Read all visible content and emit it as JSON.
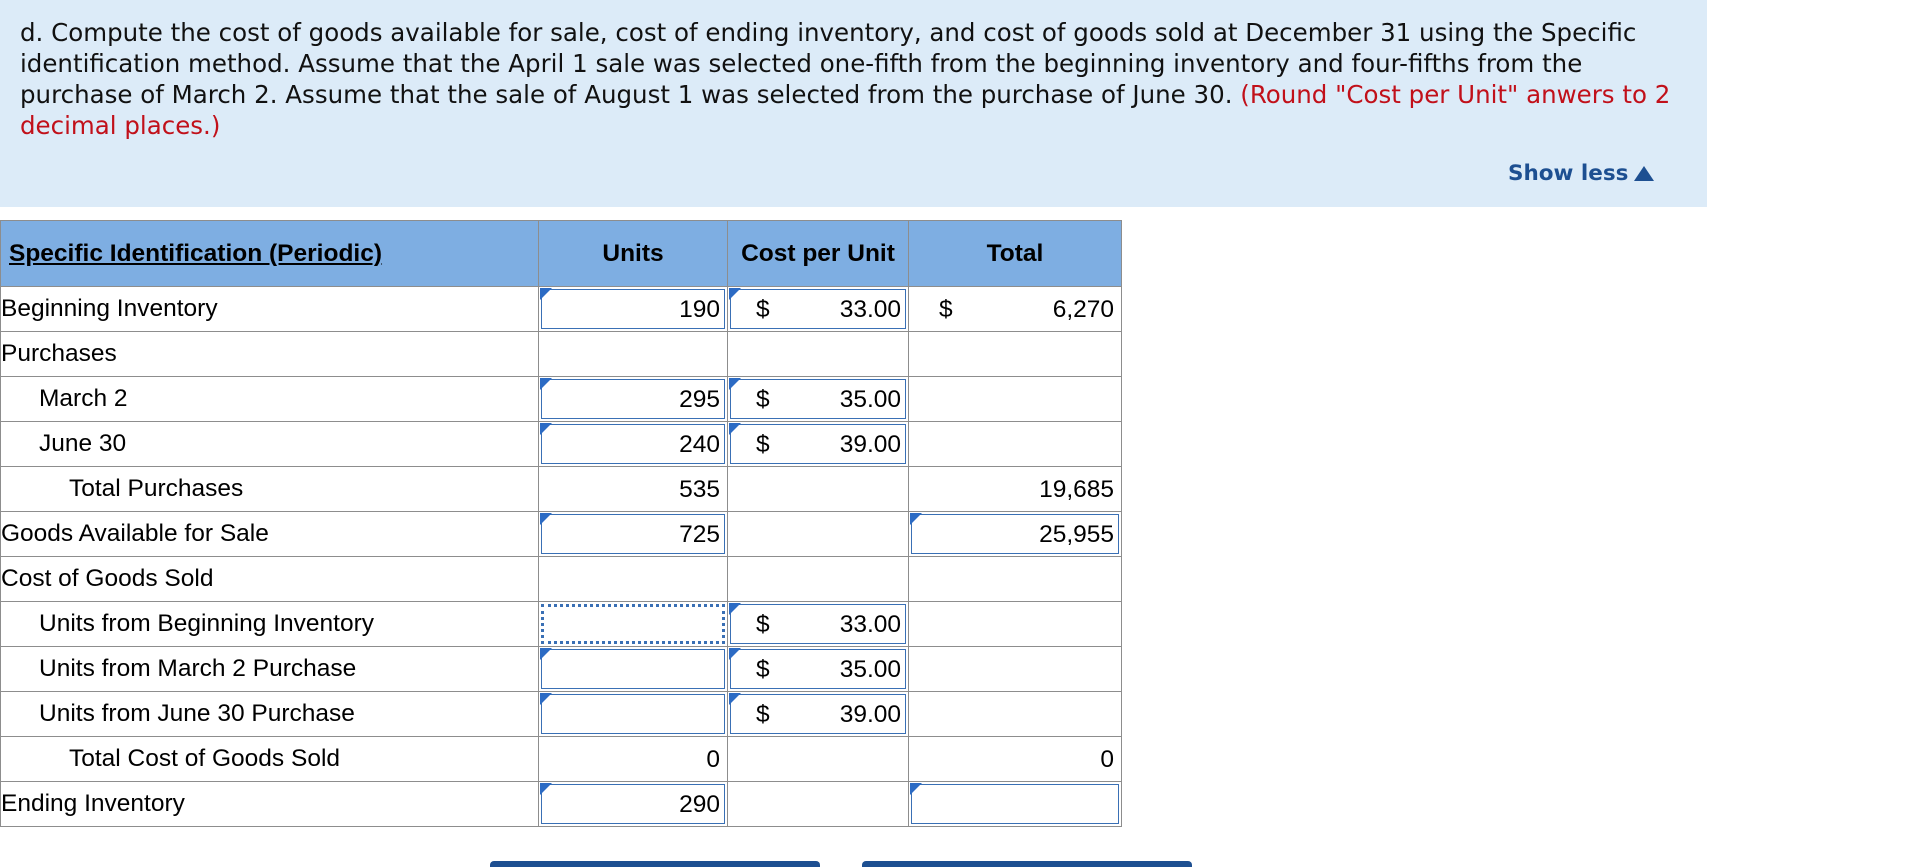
{
  "prompt": {
    "text": "d. Compute the cost of goods available for sale, cost of ending inventory, and cost of goods sold at December 31 using the Specific identification method. Assume that the April 1 sale was selected one-fifth from the beginning inventory and four-fifths from the purchase of March 2. Assume that the sale of August 1 was selected from the purchase of June 30. ",
    "note": "(Round \"Cost per Unit\" anwers to 2 decimal places.)",
    "show_less": "Show less"
  },
  "table": {
    "headers": {
      "label": "Specific Identification (Periodic)",
      "units": "Units",
      "cost": "Cost per Unit",
      "total": "Total"
    },
    "currency": "$",
    "rows": [
      {
        "label": "Beginning Inventory",
        "units": "190",
        "cost": "33.00",
        "total": "6,270"
      },
      {
        "label": "Purchases"
      },
      {
        "label": "March 2",
        "units": "295",
        "cost": "35.00"
      },
      {
        "label": "June 30",
        "units": "240",
        "cost": "39.00"
      },
      {
        "label": "Total Purchases",
        "units": "535",
        "total": "19,685"
      },
      {
        "label": "Goods Available for Sale",
        "units": "725",
        "total": "25,955"
      },
      {
        "label": "Cost of Goods Sold"
      },
      {
        "label": "Units from Beginning Inventory",
        "units": "",
        "cost": "33.00"
      },
      {
        "label": "Units from March 2 Purchase",
        "units": "",
        "cost": "35.00"
      },
      {
        "label": "Units from June 30 Purchase",
        "units": "",
        "cost": "39.00"
      },
      {
        "label": "Total Cost of Goods Sold",
        "units": "0",
        "total": "0"
      },
      {
        "label": "Ending Inventory",
        "units": "290",
        "total": ""
      }
    ]
  },
  "colors": {
    "header_bg": "#7eaee2",
    "prompt_bg": "#dcebf8",
    "input_border": "#3a70b5",
    "note_red": "#c1101a",
    "link_blue": "#1d4f91"
  }
}
